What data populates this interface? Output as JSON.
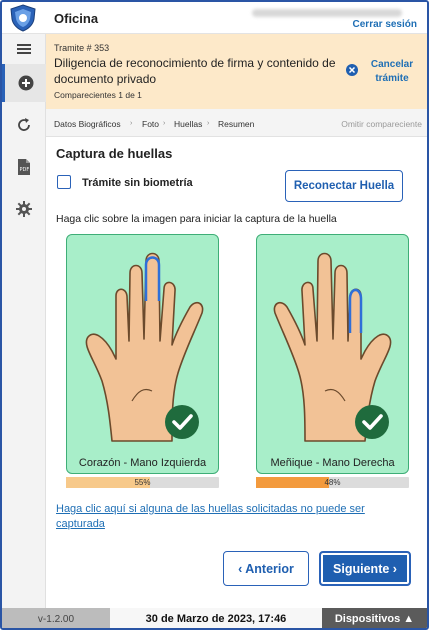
{
  "header": {
    "title": "Oficina",
    "logout": "Cerrar sesión"
  },
  "sidebar": {
    "items": [
      {
        "icon": "menu-icon"
      },
      {
        "icon": "add-circle-icon",
        "active": true
      },
      {
        "icon": "refresh-icon"
      },
      {
        "icon": "pdf-file-icon"
      },
      {
        "icon": "gear-icon"
      }
    ]
  },
  "tramite": {
    "number": "Tramite # 353",
    "title": "Diligencia de reconocimiento de firma y contenido de documento privado",
    "comparecientes": "Comparecientes 1 de 1",
    "cancel_line1": "Cancelar",
    "cancel_line2": "trámite"
  },
  "steps": {
    "items": [
      "Datos Biográficos",
      "Foto",
      "Huellas",
      "Resumen"
    ],
    "omit": "Omitir compareciente"
  },
  "capture": {
    "title": "Captura de huellas",
    "no_biometric_label": "Trámite sin biometría",
    "no_biometric_checked": false,
    "reconnect": "Reconectar Huella",
    "instruction": "Haga clic sobre la imagen para iniciar la captura de la huella",
    "hands": [
      {
        "label": "Corazón - Mano Izquierda",
        "quality_text": "55%",
        "quality": 55,
        "bar_color": "#f7c98a",
        "captured": true
      },
      {
        "label": "Meñique - Mano Derecha",
        "quality_text": "48%",
        "quality": 48,
        "bar_color": "#f39a3d",
        "captured": true
      }
    ],
    "help_link": "Haga clic aquí si alguna de las huellas solicitadas no puede ser capturada"
  },
  "nav": {
    "prev": "‹ Anterior",
    "next": "Siguiente ›"
  },
  "footer": {
    "version": "v-1.2.00",
    "datetime": "30 de Marzo de 2023, 17:46",
    "devices": "Dispositivos ▲"
  },
  "colors": {
    "accent": "#1f5fb0",
    "banner": "#fde9c9",
    "card": "#a8eec9",
    "check": "#1f6b3d"
  }
}
